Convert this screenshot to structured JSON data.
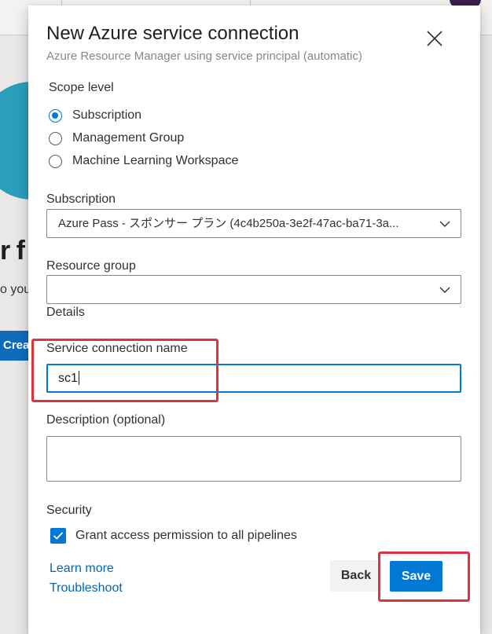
{
  "background": {
    "heading_fragment": "r f",
    "text_fragment": "o you",
    "button_fragment": "Crea"
  },
  "dialog": {
    "title": "New Azure service connection",
    "subtitle": "Azure Resource Manager using service principal (automatic)",
    "scope": {
      "label": "Scope level",
      "options": [
        {
          "label": "Subscription",
          "checked": true
        },
        {
          "label": "Management Group",
          "checked": false
        },
        {
          "label": "Machine Learning Workspace",
          "checked": false
        }
      ]
    },
    "subscription": {
      "label": "Subscription",
      "value": "Azure Pass - スポンサー プラン (4c4b250a-3e2f-47ac-ba71-3a..."
    },
    "resource_group": {
      "label": "Resource group",
      "value": ""
    },
    "details_label": "Details",
    "connection_name": {
      "label": "Service connection name",
      "value": "sc1"
    },
    "description": {
      "label": "Description (optional)",
      "value": ""
    },
    "security": {
      "label": "Security",
      "grant_access_label": "Grant access permission to all pipelines",
      "grant_access_checked": true
    },
    "links": {
      "learn_more": "Learn more",
      "troubleshoot": "Troubleshoot"
    },
    "buttons": {
      "back": "Back",
      "save": "Save"
    }
  },
  "colors": {
    "accent": "#0078d4",
    "link": "#0067b8",
    "highlight": "#d9363e"
  },
  "icons": {
    "close": "close-icon",
    "dropdown": "chevron-down-icon",
    "check": "checkmark-icon"
  }
}
